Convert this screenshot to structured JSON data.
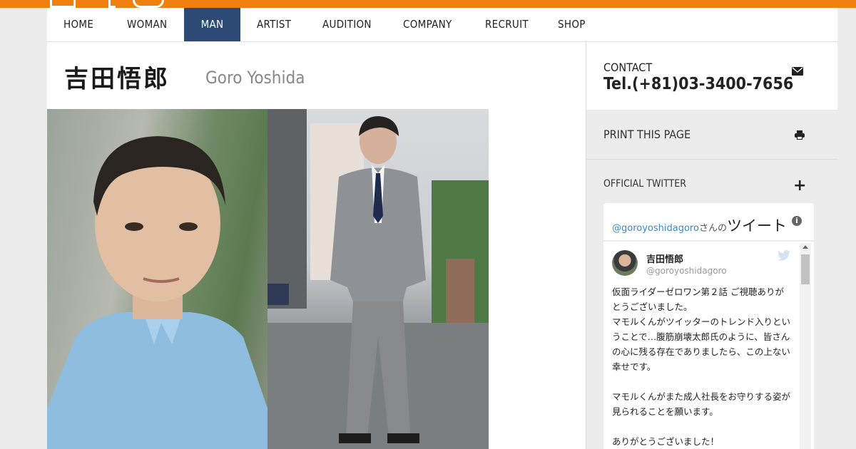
{
  "colors": {
    "accent": "#f07f0e",
    "nav_active": "#2c4a73",
    "twitter_link": "#3b88c3"
  },
  "nav": {
    "items": [
      {
        "label": "HOME"
      },
      {
        "label": "WOMAN"
      },
      {
        "label": "MAN",
        "active": true
      },
      {
        "label": "ARTIST"
      },
      {
        "label": "AUDITION"
      },
      {
        "label": "COMPANY"
      },
      {
        "label": "RECRUIT"
      },
      {
        "label": "SHOP"
      }
    ]
  },
  "profile": {
    "name_jp": "吉田悟郎",
    "name_en": "Goro Yoshida"
  },
  "sidebar": {
    "contact_label": "CONTACT",
    "contact_tel": "Tel.(+81)03-3400-7656",
    "print_label": "PRINT THIS PAGE",
    "twitter_section_label": "OFFICIAL TWITTER"
  },
  "twitter": {
    "header_handle": "@goroyoshidagoro",
    "header_suffix": "さんの",
    "header_tweets": "ツイート",
    "tweet_author": "吉田悟郎",
    "tweet_handle": "@goroyoshidagoro",
    "tweet_text": "仮面ライダーゼロワン第２話 ご視聴ありがとうございました。\nマモルくんがツイッターのトレンド入りということで…腹筋崩壊太郎氏のように、皆さんの心に残る存在でありましたら、この上ない幸せです。\n\nマモルくんがまた成人社長をお守りする姿が見られることを願います。\n\nありがとうございました！"
  },
  "icons": [
    "mail-icon",
    "print-icon",
    "plus-icon",
    "info-icon",
    "twitter-bird-icon"
  ]
}
